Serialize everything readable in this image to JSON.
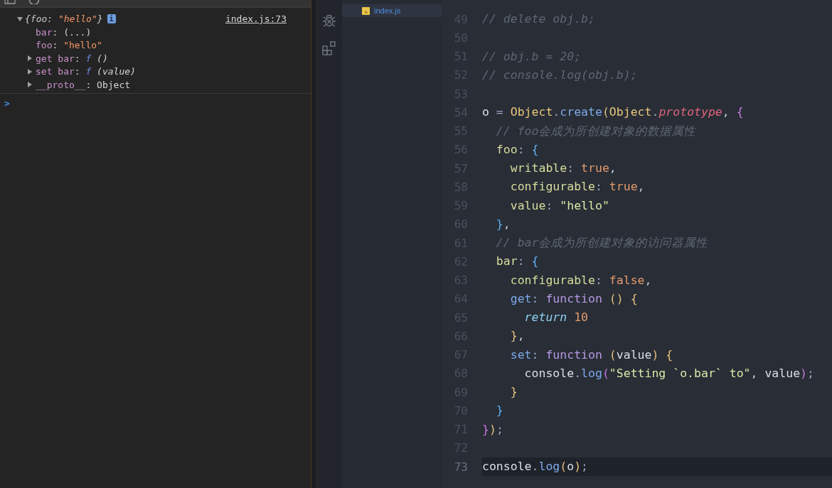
{
  "console": {
    "entry": {
      "expanded": true,
      "summary": [
        {
          "text": "{",
          "kind": "punc"
        },
        {
          "text": "foo",
          "kind": "ikey"
        },
        {
          "text": ": ",
          "kind": "punc"
        },
        {
          "text": "\"hello\"",
          "kind": "istr"
        },
        {
          "text": "}",
          "kind": "punc"
        }
      ],
      "info": "i",
      "source": "index.js:73",
      "properties": [
        {
          "tokens": [
            {
              "text": "bar",
              "kind": "name"
            },
            {
              "text": ": ",
              "kind": "punc"
            },
            {
              "text": "(...)",
              "kind": "plain"
            }
          ]
        },
        {
          "tokens": [
            {
              "text": "foo",
              "kind": "name"
            },
            {
              "text": ": ",
              "kind": "punc"
            },
            {
              "text": "\"hello\"",
              "kind": "str"
            }
          ]
        },
        {
          "expanded": false,
          "tokens": [
            {
              "text": "get bar",
              "kind": "name"
            },
            {
              "text": ": ",
              "kind": "punc"
            },
            {
              "text": "f",
              "kind": "fn"
            },
            {
              "text": " ()",
              "kind": "sig"
            }
          ]
        },
        {
          "expanded": false,
          "tokens": [
            {
              "text": "set bar",
              "kind": "name"
            },
            {
              "text": ": ",
              "kind": "punc"
            },
            {
              "text": "f",
              "kind": "fn"
            },
            {
              "text": " (value)",
              "kind": "sig"
            }
          ]
        },
        {
          "expanded": false,
          "tokens": [
            {
              "text": "__proto__",
              "kind": "name"
            },
            {
              "text": ": ",
              "kind": "punc"
            },
            {
              "text": "Object",
              "kind": "plain"
            }
          ]
        }
      ]
    },
    "prompt": ">"
  },
  "file_tree": {
    "items": [
      {
        "name": "index.js",
        "selected": true
      }
    ]
  },
  "editor": {
    "lines": [
      {
        "num": "49",
        "current": false,
        "tokens": [
          {
            "text": "// delete obj.b;",
            "kind": "comment"
          }
        ]
      },
      {
        "num": "50",
        "current": false
      },
      {
        "num": "51",
        "current": false,
        "tokens": [
          {
            "text": "// obj.b = 20;",
            "kind": "comment"
          }
        ]
      },
      {
        "num": "52",
        "current": false,
        "tokens": [
          {
            "text": "// console.log(obj.b);",
            "kind": "comment"
          }
        ]
      },
      {
        "num": "53",
        "current": false
      },
      {
        "num": "54",
        "current": false,
        "tokens": [
          {
            "text": "o",
            "kind": "var"
          },
          {
            "text": " = ",
            "kind": "op"
          },
          {
            "text": "Object",
            "kind": "class"
          },
          {
            "text": ".",
            "kind": "op"
          },
          {
            "text": "create",
            "kind": "method"
          },
          {
            "text": "(",
            "kind": "paren1"
          },
          {
            "text": "Object",
            "kind": "class"
          },
          {
            "text": ".",
            "kind": "op"
          },
          {
            "text": "prototype",
            "kind": "prop"
          },
          {
            "text": ", ",
            "kind": "plain"
          },
          {
            "text": "{",
            "kind": "brace1"
          }
        ]
      },
      {
        "num": "55",
        "current": false,
        "tokens": [
          {
            "text": "  // foo会成为所创建对象的数据属性",
            "kind": "comment"
          }
        ]
      },
      {
        "num": "56",
        "current": false,
        "tokens": [
          {
            "text": "  foo",
            "kind": "key"
          },
          {
            "text": ": ",
            "kind": "op"
          },
          {
            "text": "{",
            "kind": "brace2"
          }
        ]
      },
      {
        "num": "57",
        "current": false,
        "tokens": [
          {
            "text": "    writable",
            "kind": "key"
          },
          {
            "text": ": ",
            "kind": "op"
          },
          {
            "text": "true",
            "kind": "bool"
          },
          {
            "text": ",",
            "kind": "plain"
          }
        ]
      },
      {
        "num": "58",
        "current": false,
        "tokens": [
          {
            "text": "    configurable",
            "kind": "key"
          },
          {
            "text": ": ",
            "kind": "op"
          },
          {
            "text": "true",
            "kind": "bool"
          },
          {
            "text": ",",
            "kind": "plain"
          }
        ]
      },
      {
        "num": "59",
        "current": false,
        "tokens": [
          {
            "text": "    value",
            "kind": "key"
          },
          {
            "text": ": ",
            "kind": "op"
          },
          {
            "text": "\"hello\"",
            "kind": "str"
          }
        ]
      },
      {
        "num": "60",
        "current": false,
        "tokens": [
          {
            "text": "  }",
            "kind": "brace2"
          },
          {
            "text": ",",
            "kind": "plain"
          }
        ]
      },
      {
        "num": "61",
        "current": false,
        "tokens": [
          {
            "text": "  // bar会成为所创建对象的访问器属性",
            "kind": "comment"
          }
        ]
      },
      {
        "num": "62",
        "current": false,
        "tokens": [
          {
            "text": "  bar",
            "kind": "key"
          },
          {
            "text": ": ",
            "kind": "op"
          },
          {
            "text": "{",
            "kind": "brace2"
          }
        ]
      },
      {
        "num": "63",
        "current": false,
        "tokens": [
          {
            "text": "    configurable",
            "kind": "key"
          },
          {
            "text": ": ",
            "kind": "op"
          },
          {
            "text": "false",
            "kind": "bool"
          },
          {
            "text": ",",
            "kind": "plain"
          }
        ]
      },
      {
        "num": "64",
        "current": false,
        "tokens": [
          {
            "text": "    get",
            "kind": "accessor"
          },
          {
            "text": ": ",
            "kind": "op"
          },
          {
            "text": "function ",
            "kind": "keyword"
          },
          {
            "text": "() {",
            "kind": "paren3"
          }
        ]
      },
      {
        "num": "65",
        "current": false,
        "tokens": [
          {
            "text": "      return ",
            "kind": "return"
          },
          {
            "text": "10",
            "kind": "bool"
          }
        ]
      },
      {
        "num": "66",
        "current": false,
        "tokens": [
          {
            "text": "    }",
            "kind": "brace3"
          },
          {
            "text": ",",
            "kind": "plain"
          }
        ]
      },
      {
        "num": "67",
        "current": false,
        "tokens": [
          {
            "text": "    set",
            "kind": "accessor"
          },
          {
            "text": ": ",
            "kind": "op"
          },
          {
            "text": "function ",
            "kind": "keyword"
          },
          {
            "text": "(",
            "kind": "paren3"
          },
          {
            "text": "value",
            "kind": "var"
          },
          {
            "text": ") {",
            "kind": "paren3"
          }
        ]
      },
      {
        "num": "68",
        "current": false,
        "tokens": [
          {
            "text": "      console",
            "kind": "var"
          },
          {
            "text": ".",
            "kind": "op"
          },
          {
            "text": "log",
            "kind": "method"
          },
          {
            "text": "(",
            "kind": "brace1"
          },
          {
            "text": "\"Setting `o.bar` to\"",
            "kind": "str"
          },
          {
            "text": ", ",
            "kind": "plain"
          },
          {
            "text": "value",
            "kind": "var"
          },
          {
            "text": ")",
            "kind": "brace1"
          },
          {
            "text": ";",
            "kind": "op"
          }
        ]
      },
      {
        "num": "69",
        "current": false,
        "tokens": [
          {
            "text": "    }",
            "kind": "brace3"
          }
        ]
      },
      {
        "num": "70",
        "current": false,
        "tokens": [
          {
            "text": "  }",
            "kind": "brace2"
          }
        ]
      },
      {
        "num": "71",
        "current": false,
        "tokens": [
          {
            "text": "}",
            "kind": "brace1"
          },
          {
            "text": ")",
            "kind": "paren1"
          },
          {
            "text": ";",
            "kind": "op"
          }
        ]
      },
      {
        "num": "72",
        "current": false
      },
      {
        "num": "73",
        "current": true,
        "tokens": [
          {
            "text": "console",
            "kind": "var"
          },
          {
            "text": ".",
            "kind": "op"
          },
          {
            "text": "log",
            "kind": "method"
          },
          {
            "text": "(",
            "kind": "paren1"
          },
          {
            "text": "o",
            "kind": "var"
          },
          {
            "text": ")",
            "kind": "paren1"
          },
          {
            "text": ";",
            "kind": "op"
          }
        ]
      }
    ]
  }
}
